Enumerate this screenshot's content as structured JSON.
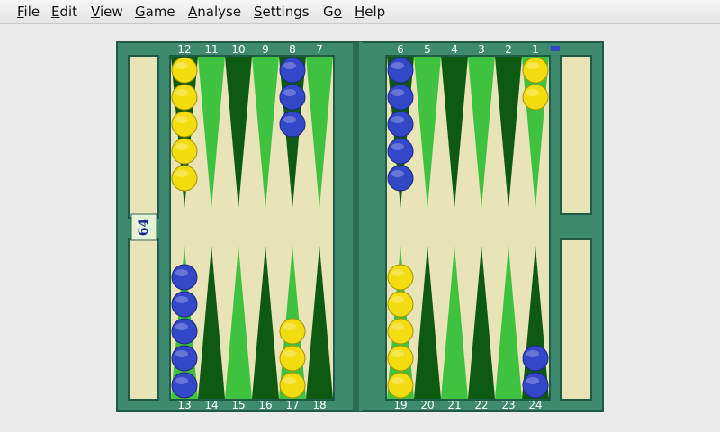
{
  "menu": [
    {
      "label": "File",
      "mnemonic": "F",
      "rest": "ile"
    },
    {
      "label": "Edit",
      "mnemonic": "E",
      "rest": "dit"
    },
    {
      "label": "View",
      "mnemonic": "V",
      "rest": "iew"
    },
    {
      "label": "Game",
      "mnemonic": "G",
      "rest": "ame"
    },
    {
      "label": "Analyse",
      "mnemonic": "A",
      "rest": "nalyse"
    },
    {
      "label": "Settings",
      "mnemonic": "S",
      "rest": "ettings"
    },
    {
      "label": "Go",
      "mnemonic": "o",
      "rest": "G",
      "underline_second": true
    },
    {
      "label": "Help",
      "mnemonic": "H",
      "rest": "elp"
    }
  ],
  "board": {
    "top_labels_left": [
      "12",
      "11",
      "10",
      "9",
      "8",
      "7"
    ],
    "top_labels_right": [
      "6",
      "5",
      "4",
      "3",
      "2",
      "1"
    ],
    "bottom_labels_left": [
      "13",
      "14",
      "15",
      "16",
      "17",
      "18"
    ],
    "bottom_labels_right": [
      "19",
      "20",
      "21",
      "22",
      "23",
      "24"
    ],
    "doubling_cube": "64",
    "colors": {
      "frame": "#3d8a6e",
      "frame_dark": "#1f5a44",
      "felt": "#e8e4b8",
      "point_light": "#3fc23f",
      "point_dark": "#0e5a12",
      "yellow_checker": "#f3dc10",
      "blue_checker": "#3347c9"
    },
    "checkers": [
      {
        "point": 12,
        "color": "yellow",
        "count": 5
      },
      {
        "point": 8,
        "color": "blue",
        "count": 3
      },
      {
        "point": 6,
        "color": "blue",
        "count": 5
      },
      {
        "point": 1,
        "color": "yellow",
        "count": 2
      },
      {
        "point": 13,
        "color": "blue",
        "count": 5
      },
      {
        "point": 17,
        "color": "yellow",
        "count": 3
      },
      {
        "point": 19,
        "color": "yellow",
        "count": 5
      },
      {
        "point": 24,
        "color": "blue",
        "count": 2
      }
    ]
  }
}
